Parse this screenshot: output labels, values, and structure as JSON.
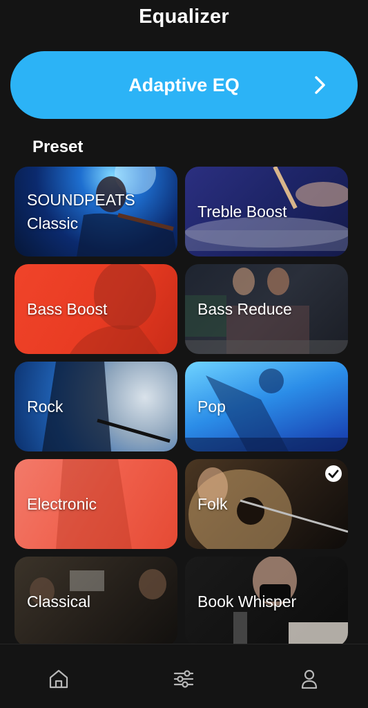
{
  "header": {
    "title": "Equalizer"
  },
  "adaptive_eq": {
    "label": "Adaptive EQ",
    "icon": "chevron-right-icon"
  },
  "section": {
    "label": "Preset"
  },
  "presets": [
    {
      "label": "SOUNDPEATS\nClassic",
      "selected": false
    },
    {
      "label": "Treble Boost",
      "selected": false
    },
    {
      "label": "Bass Boost",
      "selected": false
    },
    {
      "label": "Bass Reduce",
      "selected": false
    },
    {
      "label": "Rock",
      "selected": false
    },
    {
      "label": "Pop",
      "selected": false
    },
    {
      "label": "Electronic",
      "selected": false
    },
    {
      "label": "Folk",
      "selected": true
    },
    {
      "label": "Classical",
      "selected": false
    },
    {
      "label": "Book Whisper",
      "selected": false
    }
  ],
  "bottom_nav": {
    "items": [
      {
        "icon": "home-icon"
      },
      {
        "icon": "sliders-icon"
      },
      {
        "icon": "user-icon"
      }
    ]
  },
  "colors": {
    "accent": "#2cb3f6",
    "background": "#141414"
  }
}
